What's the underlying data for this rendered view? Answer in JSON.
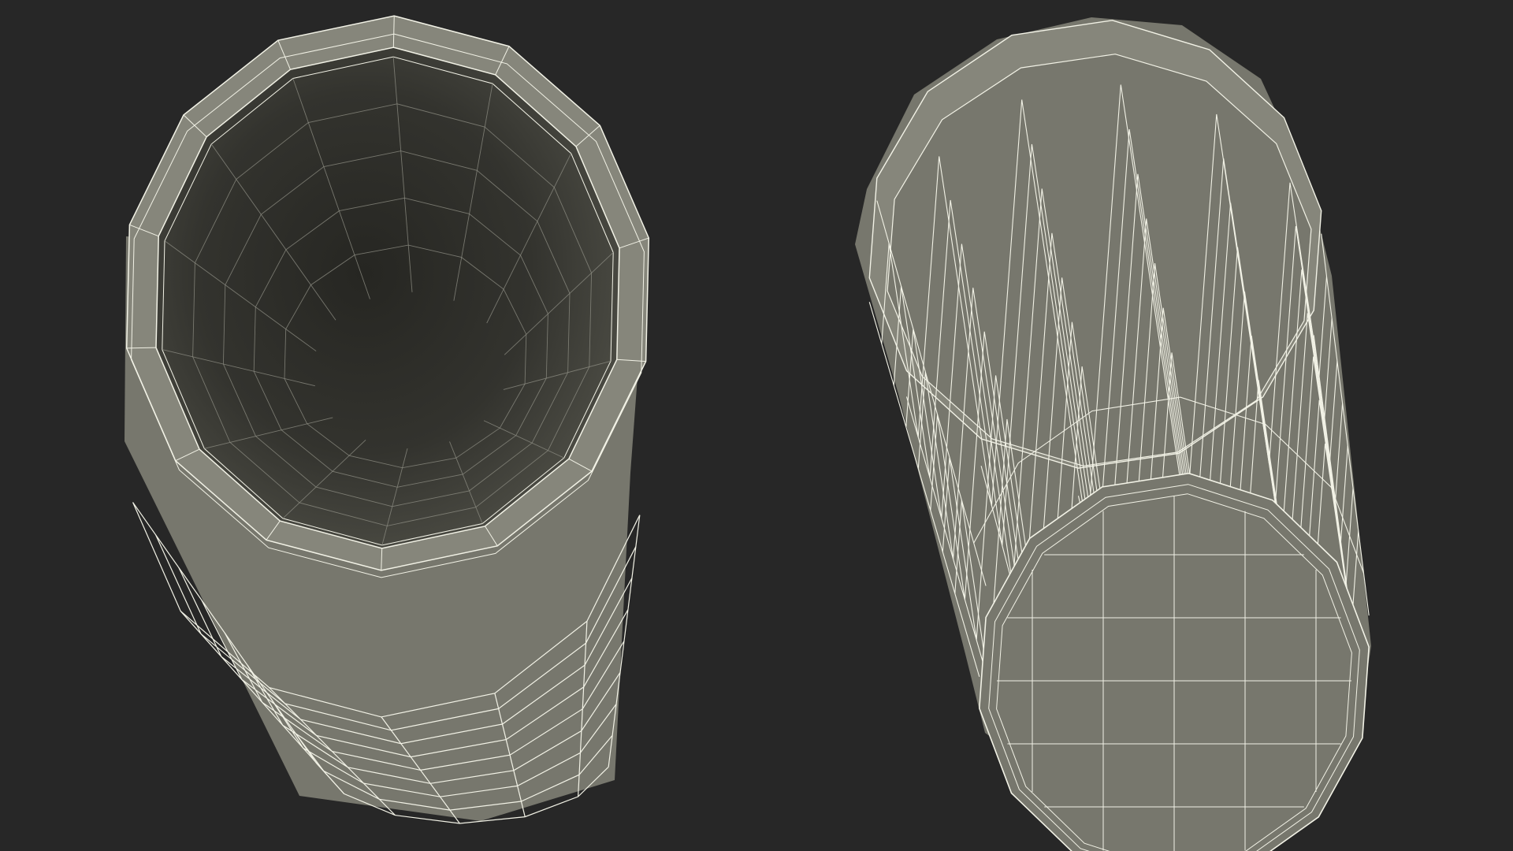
{
  "scene": {
    "background_color": "#272727",
    "surface_color": "#77776d",
    "surface_light_color": "#86867b",
    "surface_shadow_color": "#5c5c53",
    "interior_dark_color": "#2b2b27",
    "interior_light_color": "#4e4e46",
    "wire_color": "#f2f2e6",
    "objects": [
      {
        "name": "cup-open-top-view",
        "segments": 14
      },
      {
        "name": "cup-bottom-view",
        "segments": 14
      }
    ]
  }
}
